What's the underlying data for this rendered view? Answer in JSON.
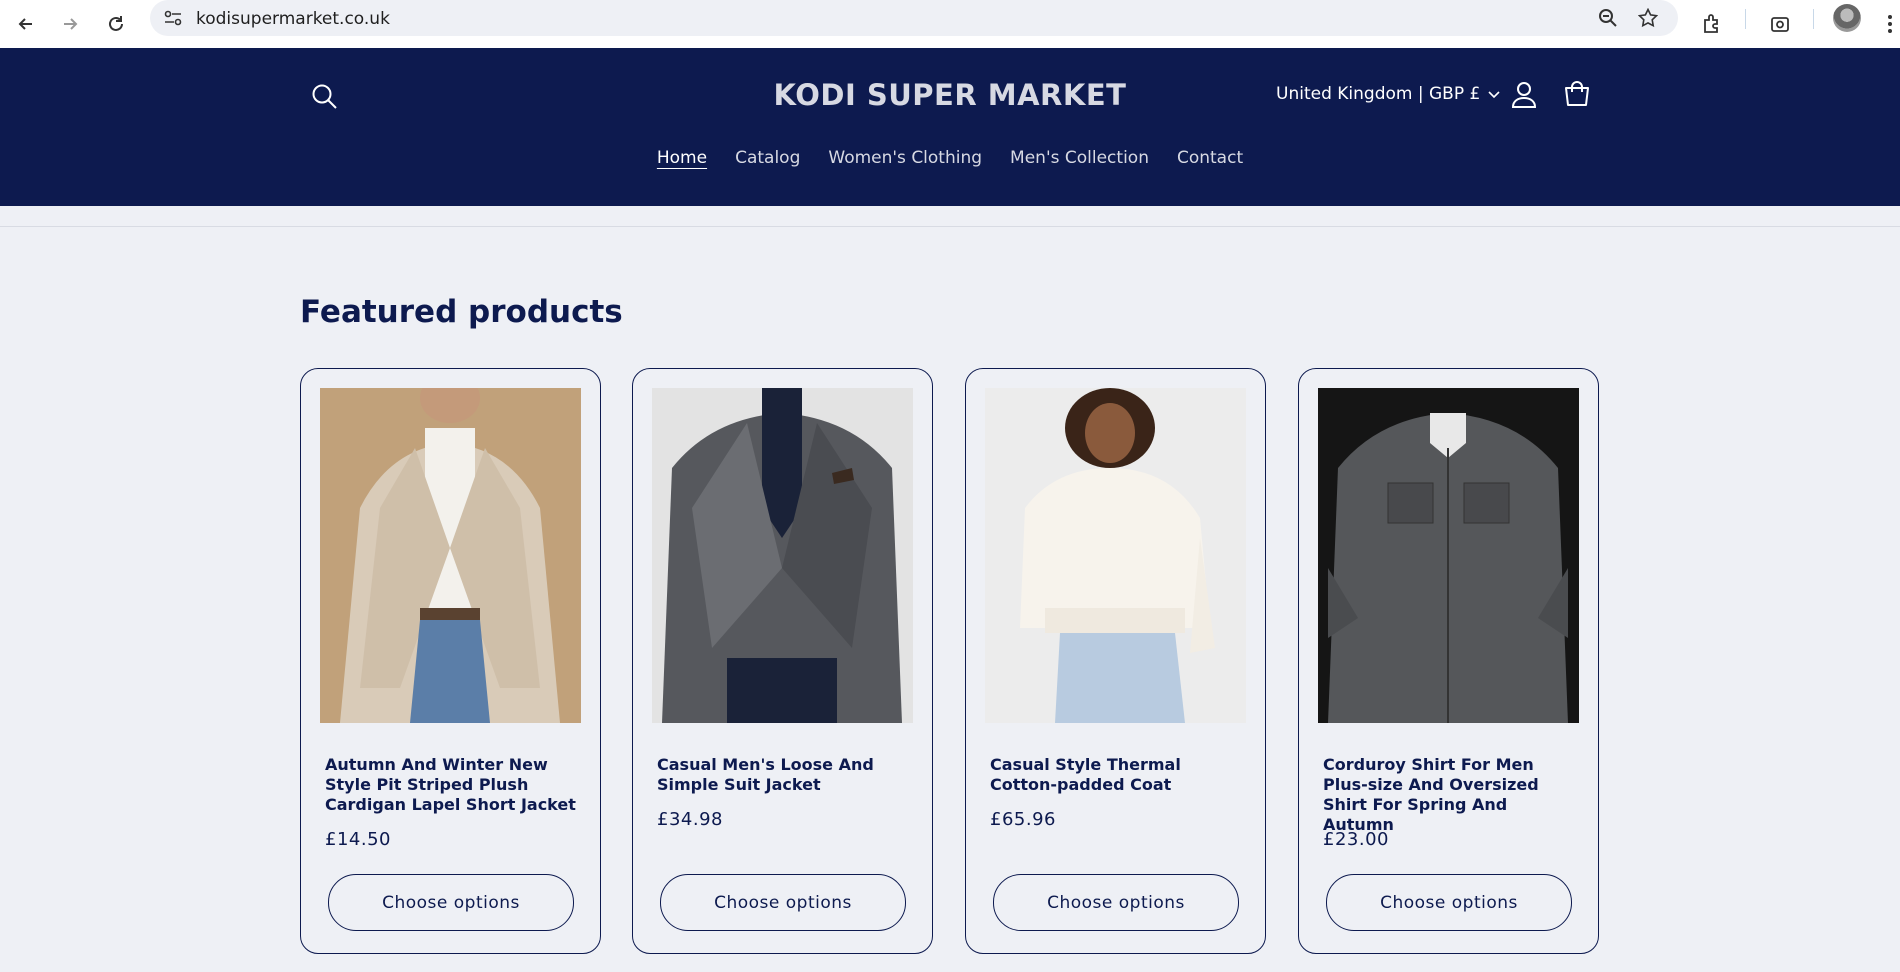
{
  "browser": {
    "url": "kodisupermarket.co.uk"
  },
  "header": {
    "brand": "KODI SUPER MARKET",
    "country_selector": "United Kingdom | GBP £",
    "menu": [
      {
        "label": "Home",
        "active": true
      },
      {
        "label": "Catalog",
        "active": false
      },
      {
        "label": "Women's Clothing",
        "active": false
      },
      {
        "label": "Men's Collection",
        "active": false
      },
      {
        "label": "Contact",
        "active": false
      }
    ]
  },
  "featured": {
    "title": "Featured products",
    "button_label": "Choose options",
    "products": [
      {
        "name": "Autumn And Winter New Style Pit Striped Plush Cardigan Lapel Short Jacket",
        "price": "£14.50",
        "image": "beige-plush-jacket"
      },
      {
        "name": "Casual Men's Loose And Simple Suit Jacket",
        "price": "£34.98",
        "image": "grey-suit-jacket"
      },
      {
        "name": "Casual Style Thermal Cotton-padded Coat",
        "price": "£65.96",
        "image": "white-padded-coat"
      },
      {
        "name": "Corduroy Shirt For Men Plus-size And Oversized Shirt For Spring And Autumn",
        "price": "£23.00",
        "image": "grey-corduroy-shirt"
      }
    ]
  },
  "colors": {
    "header_bg": "#0d1a4f",
    "page_bg": "#eef0f5",
    "text": "#0d1a4f"
  }
}
